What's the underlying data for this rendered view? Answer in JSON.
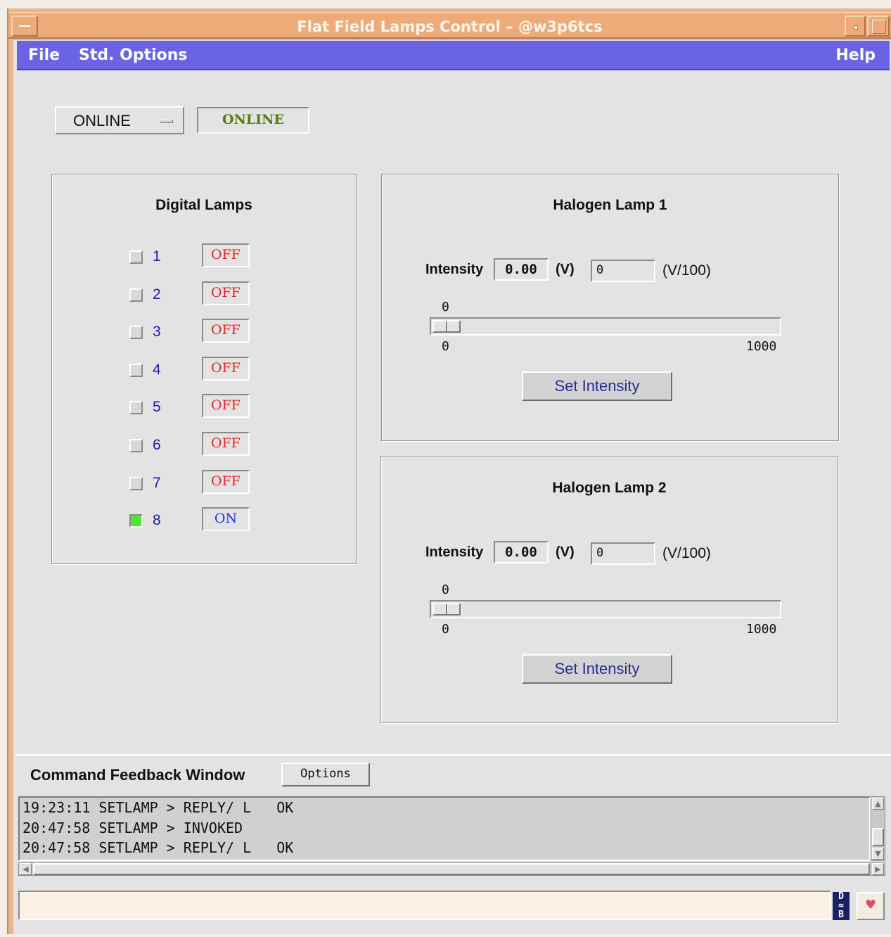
{
  "window": {
    "title": "Flat Field Lamps Control – @w3p6tcs"
  },
  "menubar": {
    "file": "File",
    "std_options": "Std. Options",
    "help": "Help"
  },
  "mode": {
    "selected": "ONLINE",
    "status": "ONLINE",
    "status_color": "#5b7a12"
  },
  "digital_lamps": {
    "title": "Digital Lamps",
    "lamps": [
      {
        "num": "1",
        "state": "OFF",
        "checked": false
      },
      {
        "num": "2",
        "state": "OFF",
        "checked": false
      },
      {
        "num": "3",
        "state": "OFF",
        "checked": false
      },
      {
        "num": "4",
        "state": "OFF",
        "checked": false
      },
      {
        "num": "5",
        "state": "OFF",
        "checked": false
      },
      {
        "num": "6",
        "state": "OFF",
        "checked": false
      },
      {
        "num": "7",
        "state": "OFF",
        "checked": false
      },
      {
        "num": "8",
        "state": "ON",
        "checked": true
      }
    ],
    "off_color": "#e2262a",
    "on_color": "#2330e0",
    "on_indicator_color": "#4ee632"
  },
  "halogen_1": {
    "title": "Halogen Lamp 1",
    "intensity_label": "Intensity",
    "value": "0.00",
    "unit": "(V)",
    "input_value": "0",
    "input_unit": "(V/100)",
    "slider_current": "0",
    "slider_min": "0",
    "slider_max": "1000",
    "slider_fraction": 0,
    "button": "Set Intensity"
  },
  "halogen_2": {
    "title": "Halogen Lamp 2",
    "intensity_label": "Intensity",
    "value": "0.00",
    "unit": "(V)",
    "input_value": "0",
    "input_unit": "(V/100)",
    "slider_current": "0",
    "slider_min": "0",
    "slider_max": "1000",
    "slider_fraction": 0,
    "button": "Set Intensity"
  },
  "feedback": {
    "title": "Command Feedback Window",
    "options_button": "Options",
    "lines": [
      "19:23:11 SETLAMP > REPLY/ L   OK",
      "20:47:58 SETLAMP > INVOKED",
      "20:47:58 SETLAMP > REPLY/ L   OK"
    ]
  },
  "command_line": {
    "value": "",
    "db_icon": "database-icon",
    "heart_icon": "heart-icon"
  },
  "colors": {
    "title_bar": "#ecab79",
    "menu_bar": "#6a64e4",
    "background": "#e3e3e3"
  }
}
